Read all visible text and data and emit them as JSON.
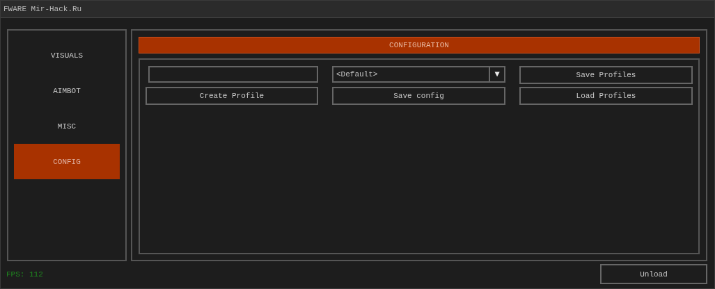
{
  "window": {
    "title": "FWARE Mir-Hack.Ru"
  },
  "sidebar": {
    "items": [
      {
        "label": "VISUALS",
        "selected": false
      },
      {
        "label": "AIMBOT",
        "selected": false
      },
      {
        "label": "MISC",
        "selected": false
      },
      {
        "label": "CONFIG",
        "selected": true
      }
    ]
  },
  "panel": {
    "header": "CONFIGURATION",
    "create_button": "Create Profile",
    "config_dropdown": {
      "value": "<Default>",
      "arrow": "▼"
    },
    "save_config_button": "Save config",
    "save_profiles_button": "Save Profiles",
    "load_profiles_button": "Load Profiles"
  },
  "status": {
    "fps": "FPS: 112"
  },
  "unload_button": "Unload"
}
